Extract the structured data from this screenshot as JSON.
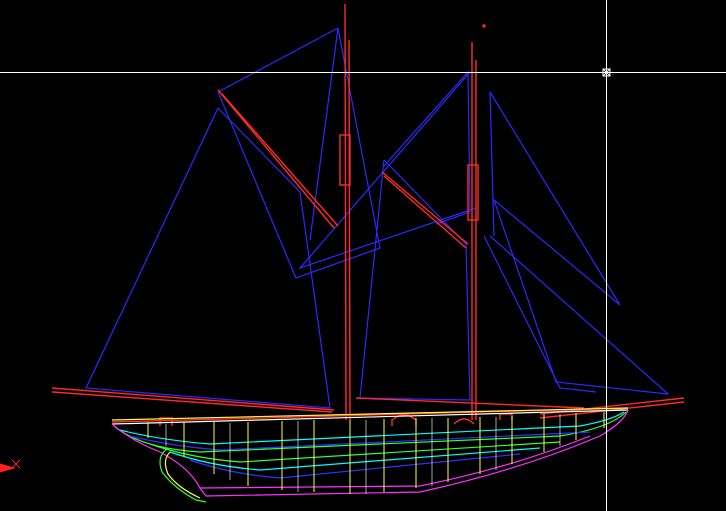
{
  "app": {
    "view": "cad-model-space",
    "background_color": "#000000"
  },
  "drawing": {
    "subject": "schooner-wireframe",
    "layer_colors": {
      "sails": "#2a2aff",
      "spars": "#ff2a2a",
      "hull_outline": "#ffffff",
      "waterline_green": "#30ff30",
      "waterline_cyan": "#00ffff",
      "waterline_blue": "#3030ff",
      "keel_magenta": "#ff30ff",
      "stations_yellow": "#ffff40",
      "crosshair": "#ffffff",
      "ucs_icon": "#ff2020"
    }
  },
  "cursor": {
    "style": "crosshair-with-pickbox"
  },
  "ucs": {
    "icon": "ucs-axis-icon"
  }
}
